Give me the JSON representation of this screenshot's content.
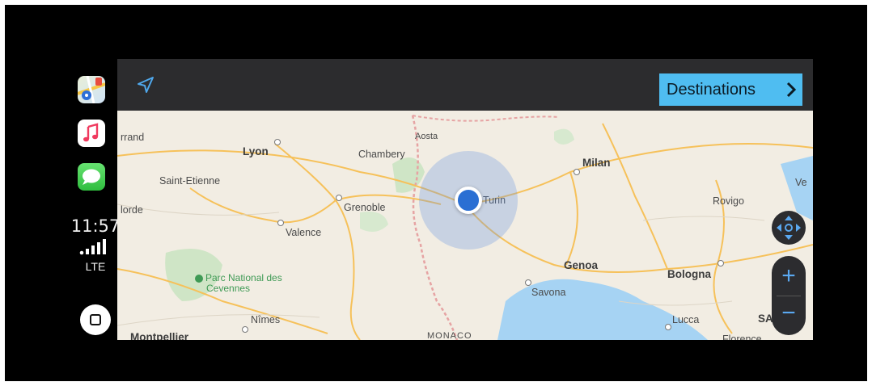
{
  "sidebar": {
    "apps": [
      {
        "name": "Maps",
        "icon": "maps-app-icon"
      },
      {
        "name": "Music",
        "icon": "music-app-icon"
      },
      {
        "name": "Messages",
        "icon": "messages-app-icon"
      }
    ],
    "status": {
      "time": "11:57",
      "network": "LTE"
    }
  },
  "map": {
    "header": {
      "destinations_label": "Destinations"
    },
    "cities": [
      {
        "label": "rrand"
      },
      {
        "label": "Lyon"
      },
      {
        "label": "Chambery"
      },
      {
        "label": "Aosta"
      },
      {
        "label": "Milan"
      },
      {
        "label": "Saint-Etienne"
      },
      {
        "label": "Grenoble"
      },
      {
        "label": "Turin"
      },
      {
        "label": "Rovigo"
      },
      {
        "label": "Ve"
      },
      {
        "label": "Valence"
      },
      {
        "label": "Genoa"
      },
      {
        "label": "Savona"
      },
      {
        "label": "Bologna"
      },
      {
        "label": "Nîmes"
      },
      {
        "label": "Lucca"
      },
      {
        "label": "Montpellier"
      },
      {
        "label": "MONACO"
      },
      {
        "label": "SA"
      },
      {
        "label": "Florence"
      },
      {
        "label": "lorde"
      }
    ],
    "park": {
      "label": "Parc National des Cevennes"
    },
    "controls": {
      "zoom_in": "+",
      "zoom_out": "−"
    }
  },
  "colors": {
    "map_land": "#f2ede3",
    "sea": "#a6d3f3",
    "destinations_bg": "#4fbdf1",
    "location_dot": "#2a6fd3",
    "roads": "#f6c15a"
  }
}
